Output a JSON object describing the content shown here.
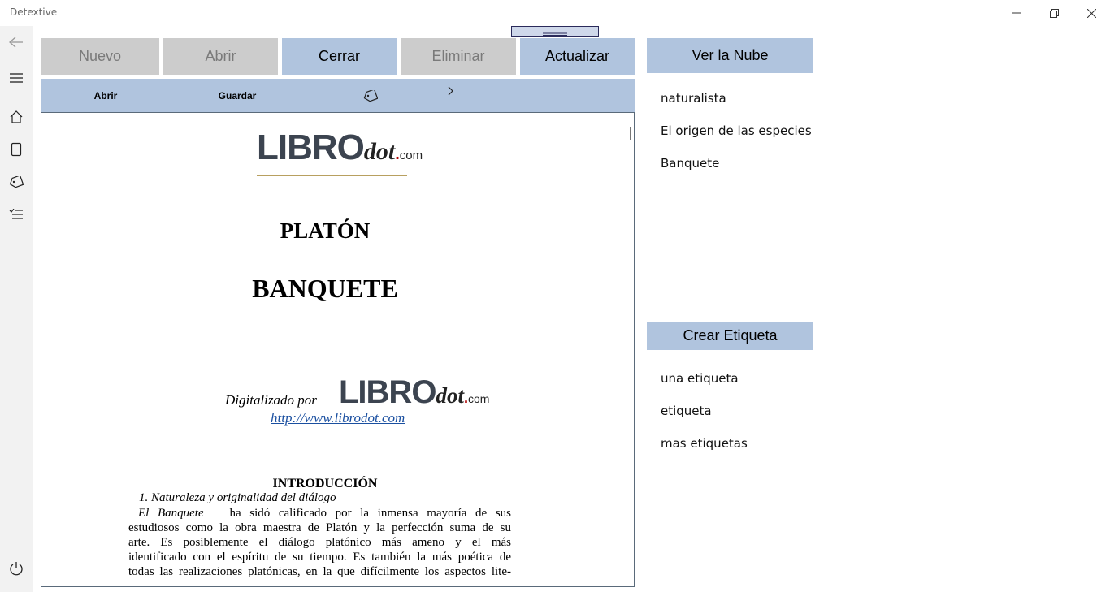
{
  "window": {
    "title": "Detextive"
  },
  "toolbar": {
    "nuevo": "Nuevo",
    "abrir": "Abrir",
    "cerrar": "Cerrar",
    "eliminar": "Eliminar",
    "actualizar": "Actualizar"
  },
  "commandbar": {
    "abrir": "Abrir",
    "guardar": "Guardar"
  },
  "document": {
    "logo": {
      "libro": "LIBRO",
      "dot": "dot",
      "sep": ".",
      "com": "com"
    },
    "author": "PLATÓN",
    "work": "BANQUETE",
    "digitized_by": "Digitalizado por",
    "url": "http://www.librodot.com",
    "section_title": "INTRODUCCIÓN",
    "subsection": "1. Naturaleza y originalidad del diálogo",
    "paragraph_start_italic": "El Banquete",
    "paragraph_lines": [
      "ha sidó calificado por la inmensa mayoría de sus",
      "estudiosos como la obra maestra de Platón y la perfección suma de su",
      "arte. Es posiblemente el diálogo platónico más ameno y el más",
      "identificado con el espíritu de su tiempo. Es también la más poética de",
      "todas las realizaciones platónicas, en la que difícilmente los aspectos lite-"
    ]
  },
  "cloud": {
    "header": "Ver la Nube",
    "items": [
      "naturalista",
      "El origen de las especies",
      "Banquete"
    ]
  },
  "tags": {
    "header": "Crear Etiqueta",
    "items": [
      "una etiqueta",
      "etiqueta",
      "mas etiquetas"
    ]
  },
  "colors": {
    "accent": "#b0c4de",
    "disabled": "#cccccc",
    "rail": "#f2f2f2"
  },
  "icons": {
    "rail": [
      "back-arrow-icon",
      "hamburger-menu-icon",
      "home-icon",
      "document-icon",
      "tag-icon",
      "checklist-icon",
      "power-icon"
    ],
    "commandbar": [
      "tag-icon",
      "chevron-right-icon"
    ]
  }
}
